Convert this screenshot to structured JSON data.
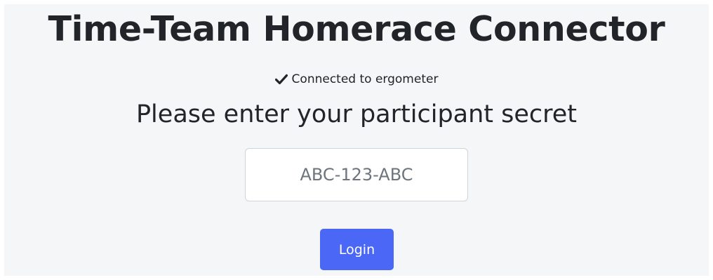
{
  "app": {
    "title": "Time-Team Homerace Connector"
  },
  "status": {
    "icon": "checkmark-icon",
    "text": "Connected to ergometer"
  },
  "form": {
    "prompt": "Please enter your participant secret",
    "secret_input": {
      "value": "",
      "placeholder": "ABC-123-ABC"
    },
    "login_label": "Login"
  },
  "colors": {
    "panel_background": "#f5f6f8",
    "text": "#212529",
    "button_primary": "#4a67f5",
    "button_text": "#ffffff",
    "input_border": "#ced4da",
    "placeholder": "#6c757d"
  }
}
